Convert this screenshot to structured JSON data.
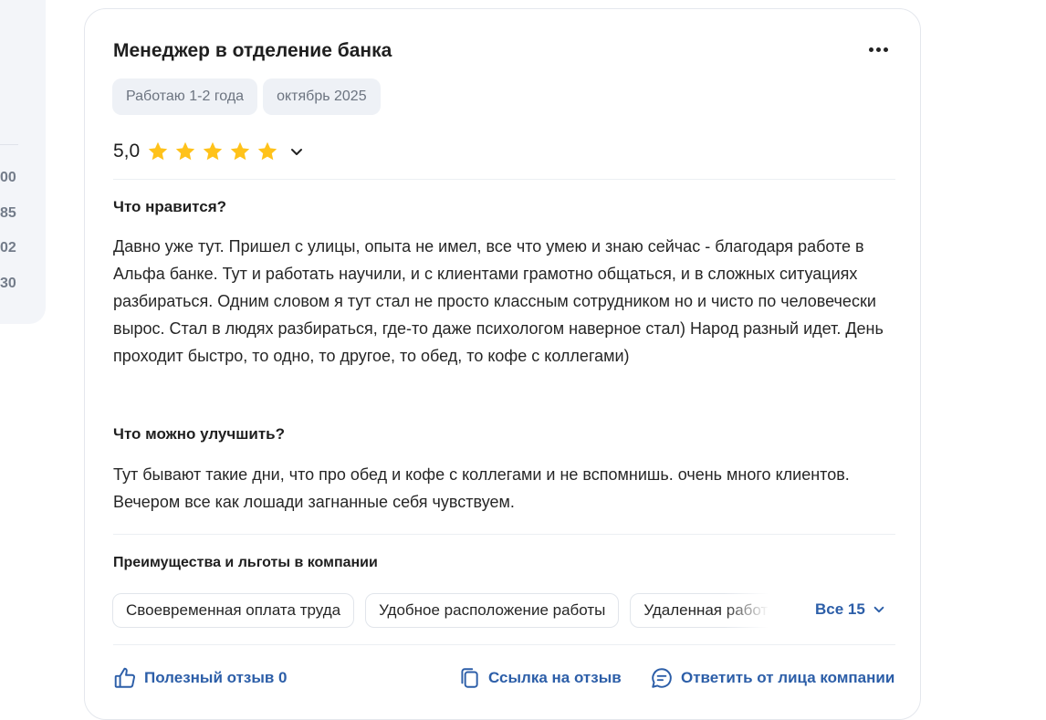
{
  "sidebar": {
    "numbers": [
      "00",
      "85",
      "02",
      "30"
    ]
  },
  "review": {
    "title": "Менеджер в отделение банка",
    "tags": [
      "Работаю 1-2 года",
      "октябрь 2025"
    ],
    "rating": {
      "value": "5,0",
      "stars": 5,
      "max_stars": 5,
      "star_color": "#ffc21a"
    },
    "likes_heading": "Что нравится?",
    "likes_text": "Давно уже тут. Пришел с улицы, опыта не имел, все что умею и знаю сейчас - благодаря работе в Альфа банке. Тут и работать научили, и с клиентами грамотно общаться, и в сложных ситуациях разбираться. Одним словом я тут стал не просто классным сотрудником но и чисто по человечески вырос. Стал в людях разбираться, где-то даже психологом наверное стал) Народ разный идет. День проходит быстро, то одно, то другое, то обед, то кофе с коллегами)",
    "improve_heading": "Что можно улучшить?",
    "improve_text": "Тут бывают такие дни, что про обед и кофе с коллегами и не вспомнишь. очень много клиентов. Вечером все как лошади загнанные себя чувствуем.",
    "benefits": {
      "title": "Преимущества и льготы в компании",
      "items": [
        "Своевременная оплата труда",
        "Удобное расположение работы",
        "Удаленная работа"
      ],
      "all_label": "Все 15"
    },
    "actions": {
      "helpful": "Полезный отзыв 0",
      "link": "Ссылка на отзыв",
      "reply": "Ответить от лица компании"
    },
    "accent_color": "#2c5ea8"
  }
}
